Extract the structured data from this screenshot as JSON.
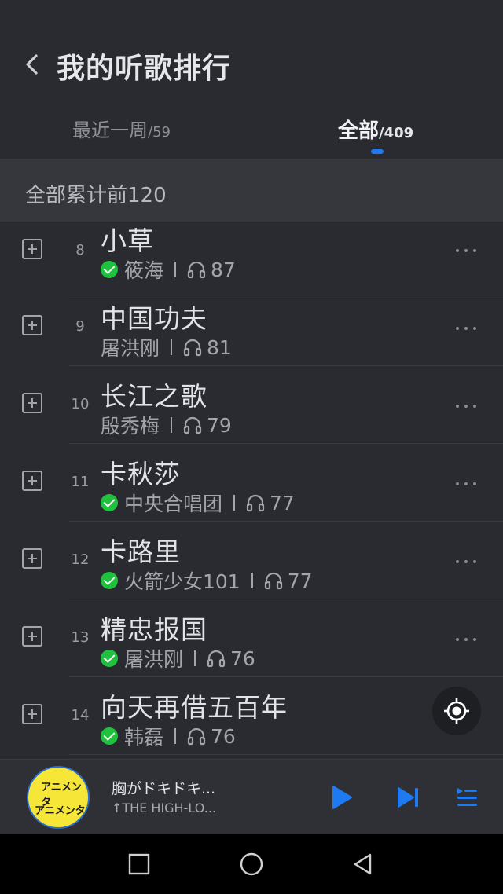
{
  "header": {
    "title": "我的听歌排行"
  },
  "tabs": [
    {
      "label": "最近一周",
      "count": "/59",
      "active": false
    },
    {
      "label": "全部",
      "count": "/409",
      "active": true
    }
  ],
  "section": {
    "label": "全部累计前120"
  },
  "rows": [
    {
      "rank": "8",
      "title": "小草",
      "artist": "筱海",
      "plays": "87",
      "verified": true
    },
    {
      "rank": "9",
      "title": "中国功夫",
      "artist": "屠洪刚",
      "plays": "81",
      "verified": false
    },
    {
      "rank": "10",
      "title": "长江之歌",
      "artist": "殷秀梅",
      "plays": "79",
      "verified": false
    },
    {
      "rank": "11",
      "title": "卡秋莎",
      "artist": "中央合唱团",
      "plays": "77",
      "verified": true
    },
    {
      "rank": "12",
      "title": "卡路里",
      "artist": "火箭少女101",
      "plays": "77",
      "verified": true
    },
    {
      "rank": "13",
      "title": "精忠报国",
      "artist": "屠洪刚",
      "plays": "76",
      "verified": true
    },
    {
      "rank": "14",
      "title": "向天再借五百年",
      "artist": "韩磊",
      "plays": "76",
      "verified": true
    }
  ],
  "player": {
    "title": "胸がドキドキ...",
    "artist": "↑THE HIGH-LO...",
    "cover_text": "アニメンタ"
  },
  "colors": {
    "accent": "#1e7af0",
    "verified": "#1ec23c",
    "background": "#2a2b30"
  },
  "icons": {
    "back": "chevron-left-icon",
    "headphones": "headphones-icon",
    "more": "more-dots-icon",
    "add": "add-square-icon",
    "locate": "locate-icon",
    "play": "play-icon",
    "next": "skip-next-icon",
    "queue": "playlist-icon"
  }
}
